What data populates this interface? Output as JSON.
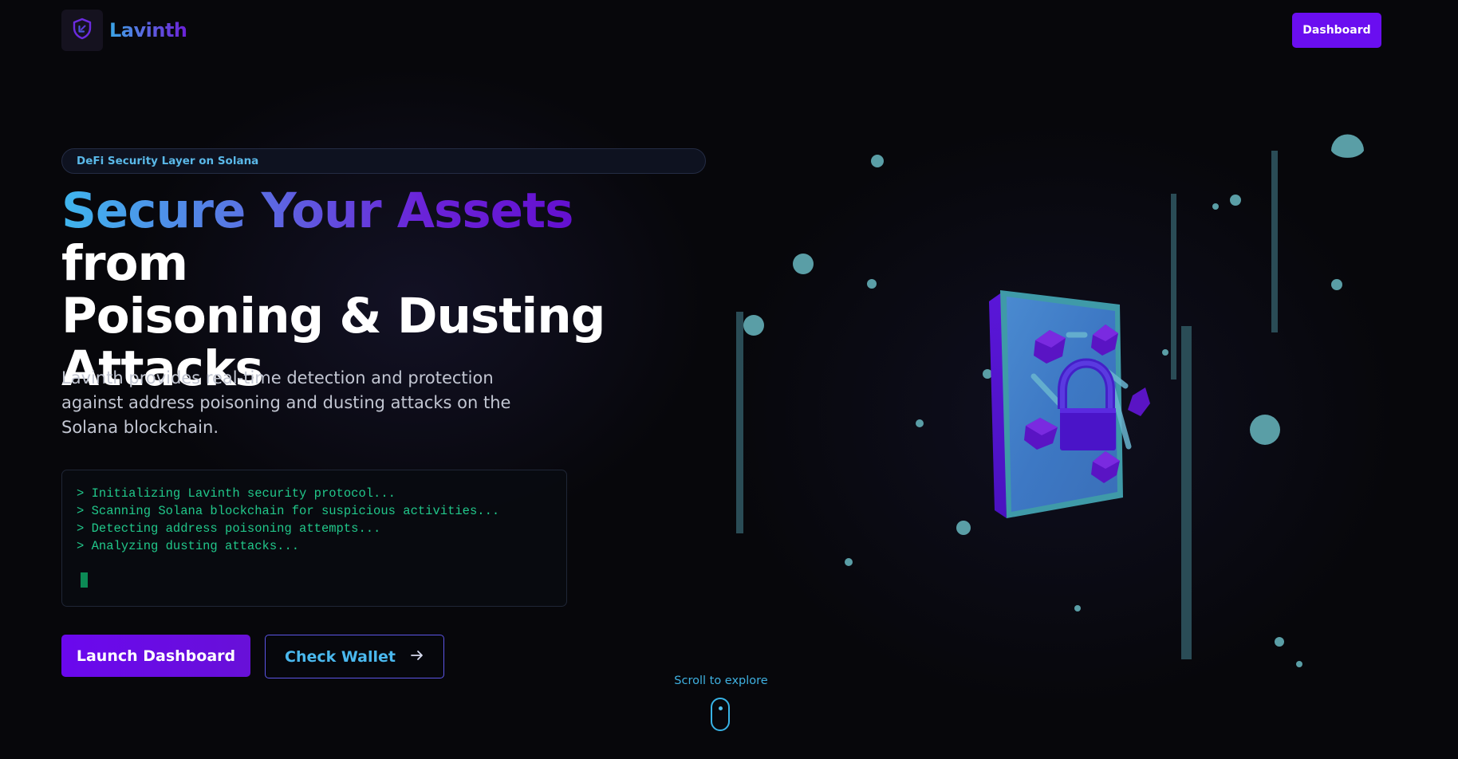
{
  "nav": {
    "brand": "Lavinth",
    "dashboard_label": "Dashboard",
    "logo_icon": "shield-icon"
  },
  "hero": {
    "badge": "DeFi Security Layer on Solana",
    "headline_gradient": "Secure Your Assets",
    "headline_rest_1": " from",
    "headline_line2": "Poisoning & Dusting",
    "headline_line3": "Attacks",
    "description": "Lavinth provides real-time detection and protection against address poisoning and dusting attacks on the Solana blockchain.",
    "terminal_lines": [
      "> Initializing Lavinth security protocol...",
      "> Scanning Solana blockchain for suspicious activities...",
      "> Detecting address poisoning attempts...",
      "> Analyzing dusting attacks..."
    ],
    "launch_label": "Launch Dashboard",
    "check_label": "Check Wallet",
    "check_icon": "arrow-right-icon"
  },
  "scroll": {
    "label": "Scroll to explore",
    "icon": "mouse-icon"
  },
  "colors": {
    "accent_purple": "#6a0ef0",
    "accent_cyan": "#3fb6ee",
    "terminal_green": "#21c78a",
    "background": "#07070b"
  }
}
